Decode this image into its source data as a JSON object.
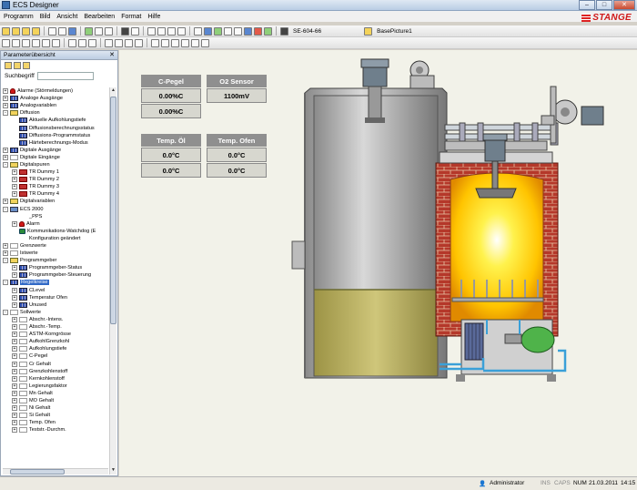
{
  "window": {
    "title": "ECS Designer"
  },
  "menu": [
    "Programm",
    "Bild",
    "Ansicht",
    "Bearbeiten",
    "Format",
    "Hilfe"
  ],
  "logo": {
    "text": "STANGE",
    "color": "#d01818"
  },
  "toolbar": {
    "controller_label": "SE-604-66",
    "picture_label": "BasePicture1"
  },
  "panel": {
    "title": "Parameterübersicht",
    "search_label": "Suchbegriff",
    "search_value": "",
    "tree": [
      {
        "label": "Alarme (Störmeldungen)",
        "indent": 0,
        "expand": "+",
        "icon": "alarm"
      },
      {
        "label": "Analoge  Ausgänge",
        "indent": 0,
        "expand": "+",
        "icon": "bits"
      },
      {
        "label": "Analogvariablen",
        "indent": 0,
        "expand": "+",
        "icon": "bits"
      },
      {
        "label": "Diffusion",
        "indent": 0,
        "expand": "-",
        "icon": "folder"
      },
      {
        "label": "Aktuelle Aufkohlungstiefe",
        "indent": 1,
        "expand": "",
        "icon": "bits"
      },
      {
        "label": "Diffusionsberechnungsstatus",
        "indent": 1,
        "expand": "",
        "icon": "bits"
      },
      {
        "label": "Diffusions-Programmstatus",
        "indent": 1,
        "expand": "",
        "icon": "bits"
      },
      {
        "label": "Härteberechnungs-Modus",
        "indent": 1,
        "expand": "",
        "icon": "bits"
      },
      {
        "label": "Digitale Ausgänge",
        "indent": 0,
        "expand": "+",
        "icon": "bits"
      },
      {
        "label": "Digitale Eingänge",
        "indent": 0,
        "expand": "+",
        "icon": "graph"
      },
      {
        "label": "Digitalspuren",
        "indent": 0,
        "expand": "-",
        "icon": "folder"
      },
      {
        "label": "TR Dummy 1",
        "indent": 1,
        "expand": "+",
        "icon": "tr"
      },
      {
        "label": "TR Dummy 2",
        "indent": 1,
        "expand": "+",
        "icon": "tr"
      },
      {
        "label": "TR Dummy 3",
        "indent": 1,
        "expand": "+",
        "icon": "tr"
      },
      {
        "label": "TR Dummy 4",
        "indent": 1,
        "expand": "+",
        "icon": "tr"
      },
      {
        "label": "Digitalvariablen",
        "indent": 0,
        "expand": "+",
        "icon": "folder"
      },
      {
        "label": "ECS 2000",
        "indent": 0,
        "expand": "-",
        "icon": "pc"
      },
      {
        "label": "_PPS",
        "indent": 1,
        "expand": "",
        "icon": "none"
      },
      {
        "label": "Alarm",
        "indent": 1,
        "expand": "+",
        "icon": "alarm"
      },
      {
        "label": "Kommunikations-Watchdog (E",
        "indent": 1,
        "expand": "",
        "icon": "arrow"
      },
      {
        "label": "Konfiguration geändert",
        "indent": 1,
        "expand": "",
        "icon": "none"
      },
      {
        "label": "Grenzwerte",
        "indent": 0,
        "expand": "+",
        "icon": "graph"
      },
      {
        "label": "Istwerte",
        "indent": 0,
        "expand": "+",
        "icon": "graph"
      },
      {
        "label": "Programmgeber",
        "indent": 0,
        "expand": "-",
        "icon": "folder"
      },
      {
        "label": "Programmgeber-Status",
        "indent": 1,
        "expand": "+",
        "icon": "bits"
      },
      {
        "label": "Programmgeber-Steuerung",
        "indent": 1,
        "expand": "+",
        "icon": "bits"
      },
      {
        "label": "Regelkreise",
        "indent": 0,
        "expand": "-",
        "icon": "bits",
        "selected": true
      },
      {
        "label": "CLevel",
        "indent": 1,
        "expand": "+",
        "icon": "bits"
      },
      {
        "label": "Temperatur Ofen",
        "indent": 1,
        "expand": "+",
        "icon": "bits"
      },
      {
        "label": "Unused",
        "indent": 1,
        "expand": "+",
        "icon": "bits"
      },
      {
        "label": "Sollwerte",
        "indent": 0,
        "expand": "-",
        "icon": "graph"
      },
      {
        "label": "Abschr.-Intens.",
        "indent": 1,
        "expand": "+",
        "icon": "graph"
      },
      {
        "label": "Abschr.-Temp.",
        "indent": 1,
        "expand": "+",
        "icon": "graph"
      },
      {
        "label": "ASTM-Korngrösse",
        "indent": 1,
        "expand": "+",
        "icon": "graph"
      },
      {
        "label": "AufkohlGrenzkohl",
        "indent": 1,
        "expand": "+",
        "icon": "graph"
      },
      {
        "label": "Aufkohlungstiefe",
        "indent": 1,
        "expand": "+",
        "icon": "graph"
      },
      {
        "label": "C-Pegel",
        "indent": 1,
        "expand": "+",
        "icon": "graph"
      },
      {
        "label": "Cr Gehalt",
        "indent": 1,
        "expand": "+",
        "icon": "graph"
      },
      {
        "label": "Grenzkohlenstoff",
        "indent": 1,
        "expand": "+",
        "icon": "graph"
      },
      {
        "label": "Kernkohlenstoff",
        "indent": 1,
        "expand": "+",
        "icon": "graph"
      },
      {
        "label": "Legierungsfaktor",
        "indent": 1,
        "expand": "+",
        "icon": "graph"
      },
      {
        "label": "Mn Gehalt",
        "indent": 1,
        "expand": "+",
        "icon": "graph"
      },
      {
        "label": "MO Gehalt",
        "indent": 1,
        "expand": "+",
        "icon": "graph"
      },
      {
        "label": "Ni Gehalt",
        "indent": 1,
        "expand": "+",
        "icon": "graph"
      },
      {
        "label": "Si Gehalt",
        "indent": 1,
        "expand": "+",
        "icon": "graph"
      },
      {
        "label": "Temp. Ofen",
        "indent": 1,
        "expand": "+",
        "icon": "graph"
      },
      {
        "label": "Teststr.-Durchm.",
        "indent": 1,
        "expand": "+",
        "icon": "graph"
      }
    ]
  },
  "values": {
    "cpegel_label": "C-Pegel",
    "cpegel_value1": "0.00%C",
    "cpegel_value2": "0.00%C",
    "o2_label": "O2 Sensor",
    "o2_value": "1100mV",
    "temp_oel_label": "Temp. Öl",
    "temp_oel_v1": "0.0°C",
    "temp_oel_v2": "0.0°C",
    "temp_ofen_label": "Temp. Ofen",
    "temp_ofen_v1": "0.0°C",
    "temp_ofen_v2": "0.0°C"
  },
  "status": {
    "user": "Administrator",
    "ins": "INS",
    "caps": "CAPS",
    "num": "NUM",
    "date": "21.03.2011",
    "time": "14:15"
  },
  "colors": {
    "accent": "#3169c6",
    "brick": "#b5382a",
    "flame": "#ffd000",
    "oil": "#b7ad5a"
  }
}
